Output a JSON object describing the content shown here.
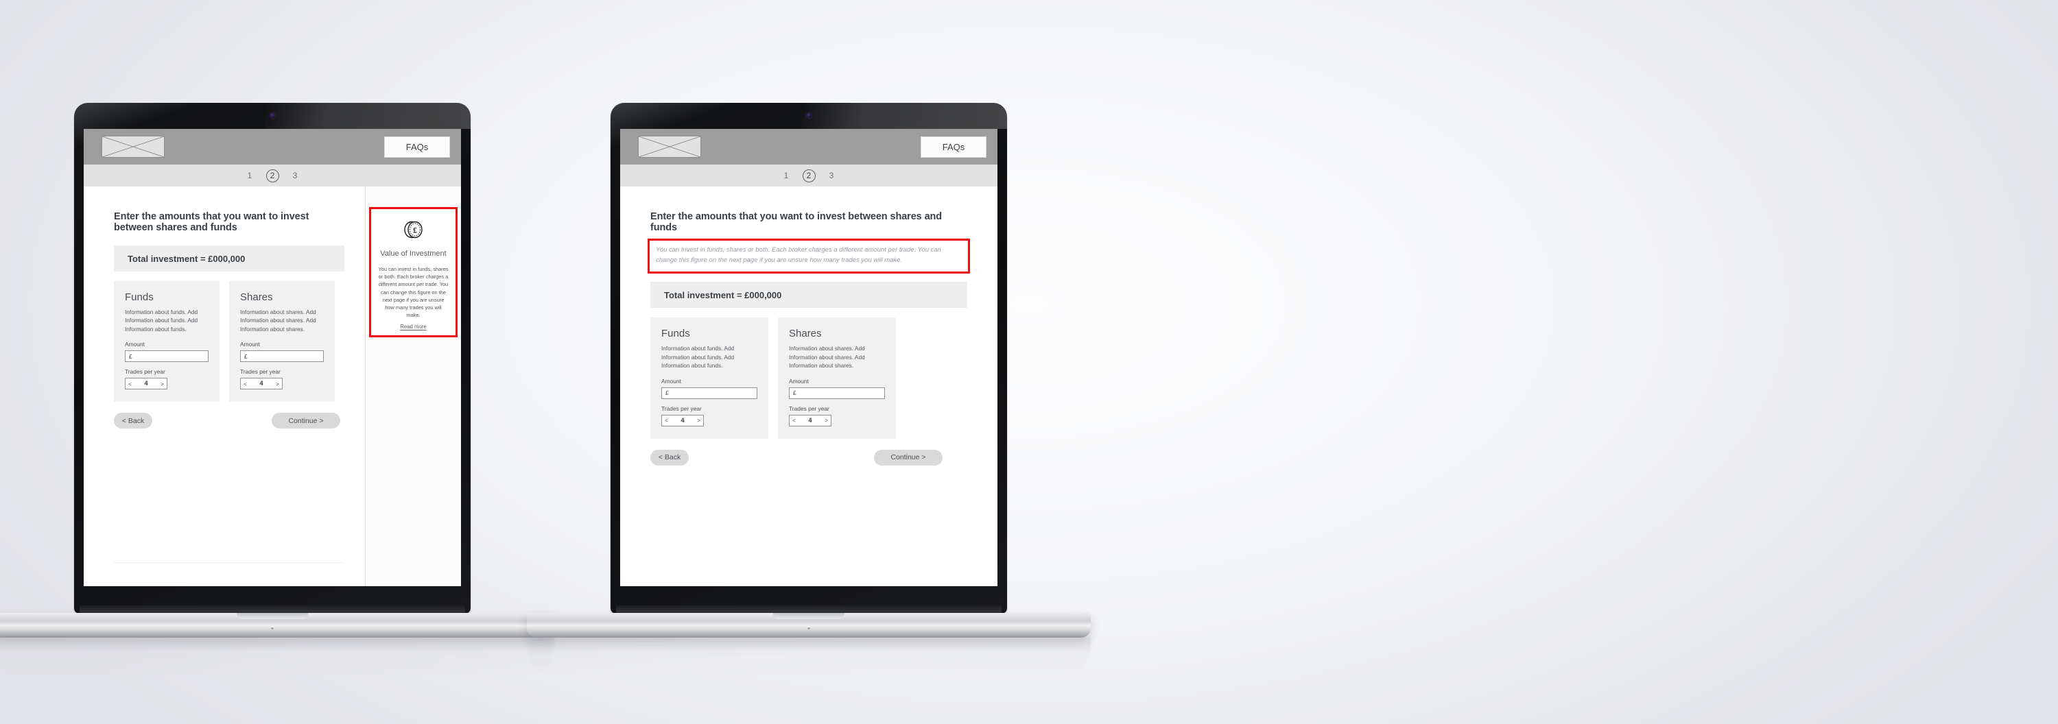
{
  "theme": {
    "highlight_color": "#ee1111",
    "header_bg": "#9d9d9d",
    "steps_bg": "#e2e2e2",
    "card_bg": "#f1f1f1",
    "button_bg": "#d9d9d9"
  },
  "header": {
    "logo_name": "placeholder-logo",
    "faq_label": "FAQs"
  },
  "steps": {
    "items": [
      "1",
      "2",
      "3"
    ],
    "current": "2"
  },
  "page": {
    "title": "Enter the amounts that you want to invest between shares and funds",
    "intro_note": "You can invest in funds, shares or both. Each broker charges a different amount per trade. You can change this figure on the next page if you are unsure how many trades you will make.",
    "total_label": "Total investment = £000,000"
  },
  "cards": [
    {
      "title": "Funds",
      "description": "Information about funds. Add Information about funds. Add Information about funds.",
      "amount_label": "Amount",
      "amount_value": "£",
      "amount_placeholder": "£",
      "trades_label": "Trades per year",
      "trades_value": "4",
      "decrement": "<",
      "increment": ">"
    },
    {
      "title": "Shares",
      "description": "Information about shares. Add Information about shares. Add Information about shares.",
      "amount_label": "Amount",
      "amount_value": "£",
      "amount_placeholder": "£",
      "trades_label": "Trades per year",
      "trades_value": "4",
      "decrement": "<",
      "increment": ">"
    }
  ],
  "actions": {
    "back_label": "< Back",
    "continue_label": "Continue >"
  },
  "promo": {
    "icon_name": "pound-coin-icon",
    "title": "Value of Investment",
    "text": "You can invest in funds, shares or both. Each broker charges a different amount per trade. You can change this figure on the next page if you are unsure how many trades you will make.",
    "read_more_label": "Read more"
  }
}
